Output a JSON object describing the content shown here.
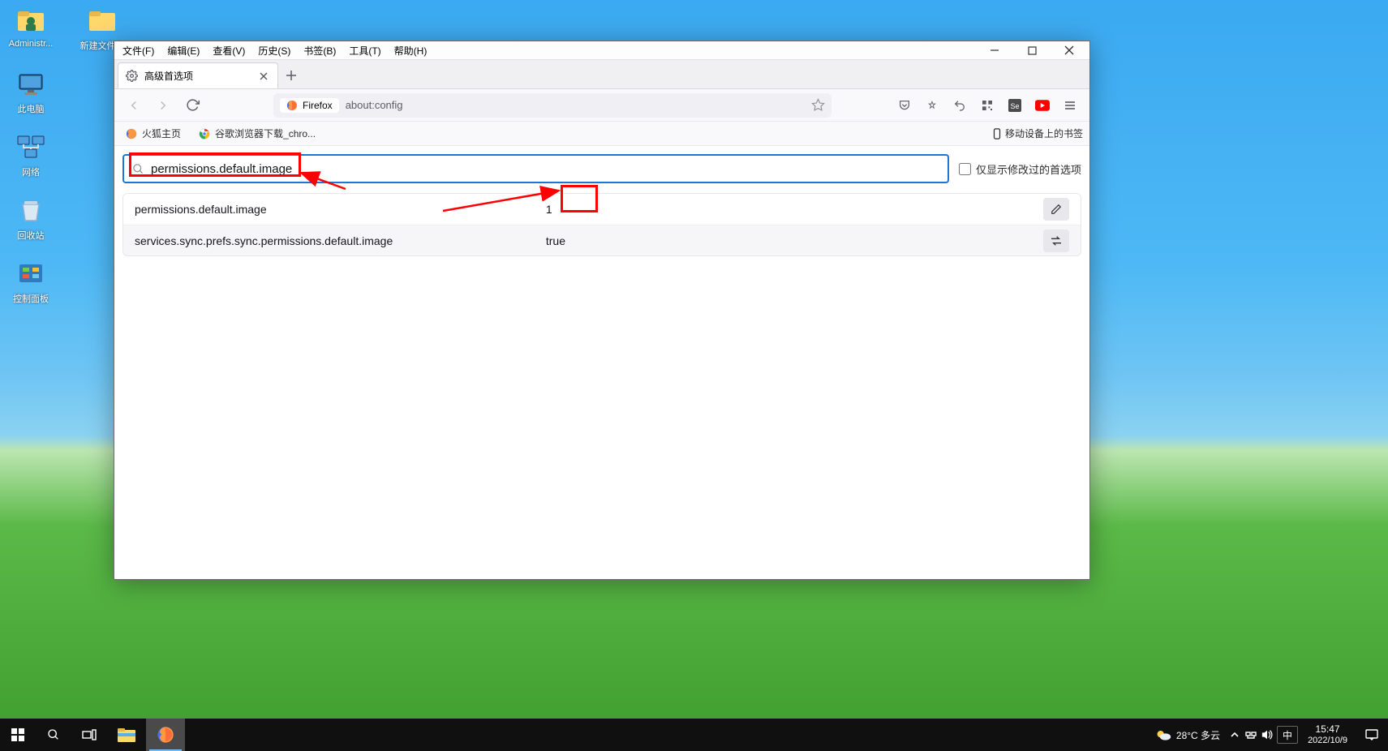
{
  "desktop_icons": {
    "admin": "Administr...",
    "new_folder": "新建文件夹",
    "this_pc": "此电脑",
    "network": "网络",
    "recycle": "回收站",
    "control_panel": "控制面板"
  },
  "menubar": {
    "file": "文件(F)",
    "edit": "编辑(E)",
    "view": "查看(V)",
    "history": "历史(S)",
    "bookmarks": "书签(B)",
    "tools": "工具(T)",
    "help": "帮助(H)"
  },
  "tab": {
    "title": "高级首选项"
  },
  "urlbar": {
    "identity": "Firefox",
    "url": "about:config"
  },
  "bookmarks": {
    "firefox_home": "火狐主页",
    "chrome_dl": "谷歌浏览器下载_chro...",
    "mobile": "移动设备上的书签"
  },
  "config": {
    "search_value": "permissions.default.image",
    "only_modified_label": "仅显示修改过的首选项",
    "rows": [
      {
        "name": "permissions.default.image",
        "value": "1",
        "action": "edit"
      },
      {
        "name": "services.sync.prefs.sync.permissions.default.image",
        "value": "true",
        "action": "toggle"
      }
    ]
  },
  "taskbar": {
    "weather": "28°C 多云",
    "ime": "中",
    "time": "15:47",
    "date": "2022/10/9"
  }
}
